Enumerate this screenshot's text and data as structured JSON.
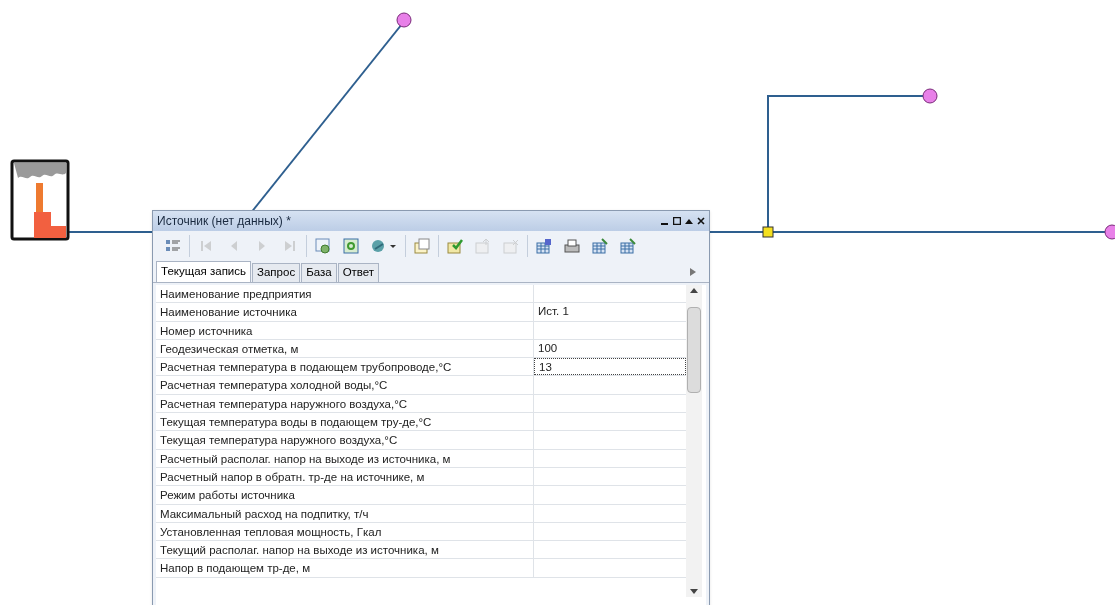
{
  "window": {
    "title": "Источник (нет данных) *"
  },
  "toolbar": [
    {
      "buttons": [
        {
          "kind": "list",
          "disabled": false
        }
      ]
    },
    {
      "buttons": [
        {
          "kind": "first",
          "disabled": true
        },
        {
          "kind": "prev",
          "disabled": true
        },
        {
          "kind": "next",
          "disabled": true
        },
        {
          "kind": "last",
          "disabled": true
        }
      ]
    },
    {
      "buttons": [
        {
          "kind": "refresh",
          "disabled": false
        },
        {
          "kind": "update",
          "disabled": false
        },
        {
          "kind": "globe",
          "disabled": false
        }
      ]
    },
    {
      "buttons": [
        {
          "kind": "page",
          "disabled": false
        }
      ]
    },
    {
      "buttons": [
        {
          "kind": "check",
          "disabled": false
        },
        {
          "kind": "export",
          "disabled": true
        },
        {
          "kind": "delete",
          "disabled": true
        }
      ]
    },
    {
      "buttons": [
        {
          "kind": "db",
          "disabled": false
        },
        {
          "kind": "print",
          "disabled": false
        },
        {
          "kind": "table",
          "disabled": false
        },
        {
          "kind": "table",
          "disabled": false
        }
      ]
    }
  ],
  "tabs": [
    {
      "label": "Текущая запись",
      "selected": true
    },
    {
      "label": "Запрос",
      "selected": false
    },
    {
      "label": "База",
      "selected": false
    },
    {
      "label": "Ответ",
      "selected": false
    }
  ],
  "rows": [
    {
      "name": "Наименование предприятия",
      "selected": false
    },
    {
      "name": "Наименование источника",
      "value": "Ист. 1",
      "selected": false
    },
    {
      "name": "Номер источника",
      "selected": false
    },
    {
      "name": "Геодезическая отметка, м",
      "value": "100",
      "selected": false
    },
    {
      "name": "Расчетная температура в подающем трубопроводе,°С",
      "value": "13",
      "selected": true
    },
    {
      "name": "Расчетная температура холодной воды,°С",
      "selected": false
    },
    {
      "name": "Расчетная температура наружного воздуха,°С",
      "selected": false
    },
    {
      "name": "Текущая температура воды в подающем тру-де,°С",
      "selected": false
    },
    {
      "name": "Текущая температура  наружного воздуха,°С",
      "selected": false
    },
    {
      "name": "Расчетный располаг. напор на выходе из источника, м",
      "selected": false
    },
    {
      "name": "Расчетный напор в обратн. тр-де на источнике, м",
      "selected": false
    },
    {
      "name": "Режим работы источника",
      "selected": false
    },
    {
      "name": "Максимальный расход на подпитку, т/ч",
      "selected": false
    },
    {
      "name": "Установленная тепловая мощность, Гкал",
      "selected": false
    },
    {
      "name": "Текущий располаг. напор на выходе из источника, м",
      "selected": false
    },
    {
      "name": "Напор в подающем тр-де, м",
      "selected": false
    }
  ]
}
